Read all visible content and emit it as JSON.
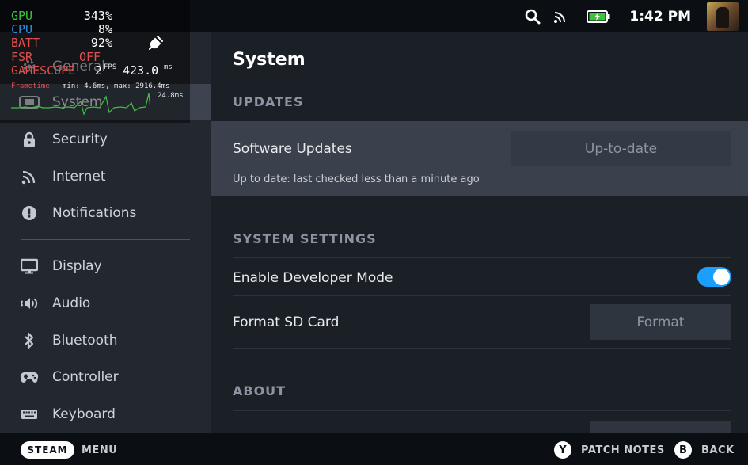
{
  "status_bar": {
    "time": "1:42 PM",
    "icons": [
      "search-icon",
      "signal-icon",
      "battery-charging-icon"
    ],
    "accent_color": "#1a9fff"
  },
  "overlay": {
    "gpu": {
      "label": "GPU",
      "value": "343%",
      "color": "#3ec23e"
    },
    "cpu": {
      "label": "CPU",
      "value": "8%",
      "color": "#2f8fe0"
    },
    "batt": {
      "label": "BATT",
      "value": "92%",
      "color": "#e05050"
    },
    "fsr": {
      "label": "FSR",
      "value": "OFF",
      "color": "#e05050"
    },
    "gamescope": {
      "label": "GAMESCOPE",
      "fps_value": "2",
      "fps_unit": "FPS",
      "ms_value": "423.0",
      "ms_unit": "ms",
      "color": "#e05050"
    },
    "frametime": {
      "label": "Frametime",
      "stats": "min: 4.6ms, max: 2916.4ms",
      "current": "24.8ms"
    }
  },
  "sidebar": {
    "items": [
      {
        "label": "General",
        "icon": "gear-icon"
      },
      {
        "label": "System",
        "icon": "steam-deck-icon",
        "active": true
      },
      {
        "label": "Security",
        "icon": "lock-icon"
      },
      {
        "label": "Internet",
        "icon": "wifi-icon"
      },
      {
        "label": "Notifications",
        "icon": "alert-icon"
      },
      {
        "label": "Display",
        "icon": "monitor-icon"
      },
      {
        "label": "Audio",
        "icon": "speaker-icon"
      },
      {
        "label": "Bluetooth",
        "icon": "bluetooth-icon"
      },
      {
        "label": "Controller",
        "icon": "gamepad-icon"
      },
      {
        "label": "Keyboard",
        "icon": "keyboard-icon"
      }
    ]
  },
  "main": {
    "title": "System",
    "updates": {
      "heading": "UPDATES",
      "software_updates_label": "Software Updates",
      "software_updates_button": "Up-to-date",
      "status": "Up to date: last checked less than a minute ago"
    },
    "system_settings": {
      "heading": "SYSTEM SETTINGS",
      "developer_mode_label": "Enable Developer Mode",
      "developer_mode_on": true,
      "format_sd_label": "Format SD Card",
      "format_button": "Format"
    },
    "about": {
      "heading": "ABOUT"
    }
  },
  "bottom_bar": {
    "steam_button": "STEAM",
    "menu_label": "MENU",
    "y_button": "Y",
    "patch_notes_label": "PATCH NOTES",
    "b_button": "B",
    "back_label": "BACK"
  }
}
